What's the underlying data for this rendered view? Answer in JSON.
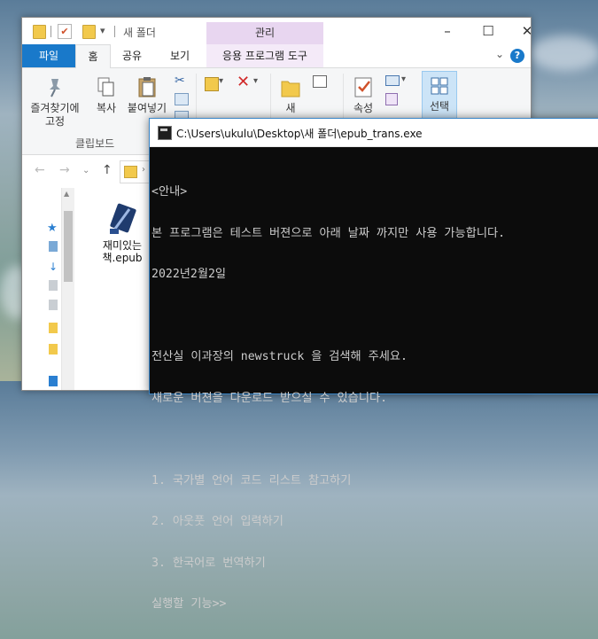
{
  "explorer": {
    "title": "새 폴더",
    "manage_tab": "관리",
    "tabs": {
      "file": "파일",
      "home": "홈",
      "share": "공유",
      "view": "보기",
      "app_tools": "응용 프로그램 도구"
    },
    "ribbon": {
      "pin_label_line1": "즐겨찾기에",
      "pin_label_line2": "고정",
      "copy_label": "복사",
      "paste_label": "붙여넣기",
      "new_folder_label": "새",
      "properties_label": "속성",
      "select_label": "선택",
      "clipboard_group": "클립보드"
    },
    "file": {
      "name_line1": "재미있는",
      "name_line2": "책.epub"
    }
  },
  "console": {
    "title": "C:\\Users\\ukulu\\Desktop\\새 폴더\\epub_trans.exe",
    "lines": [
      "<안내>",
      "본 프로그램은 테스트 버젼으로 아래 날짜 까지만 사용 가능합니다.",
      "2022년2월2일",
      "",
      "전산실 이과장의 newstruck 을 검색해 주세요.",
      "새로운 버젼을 다운로드 받으실 수 있습니다.",
      "",
      "1. 국가별 언어 코드 리스트 참고하기",
      "2. 아웃풋 언어 입력하기",
      "3. 한국어로 번역하기",
      "실행할 기능>>"
    ]
  },
  "colors": {
    "file_tab": "#1979ca",
    "manage_tab": "#e8d6f0",
    "console_bg": "#0c0c0c",
    "console_text": "#cccccc"
  }
}
